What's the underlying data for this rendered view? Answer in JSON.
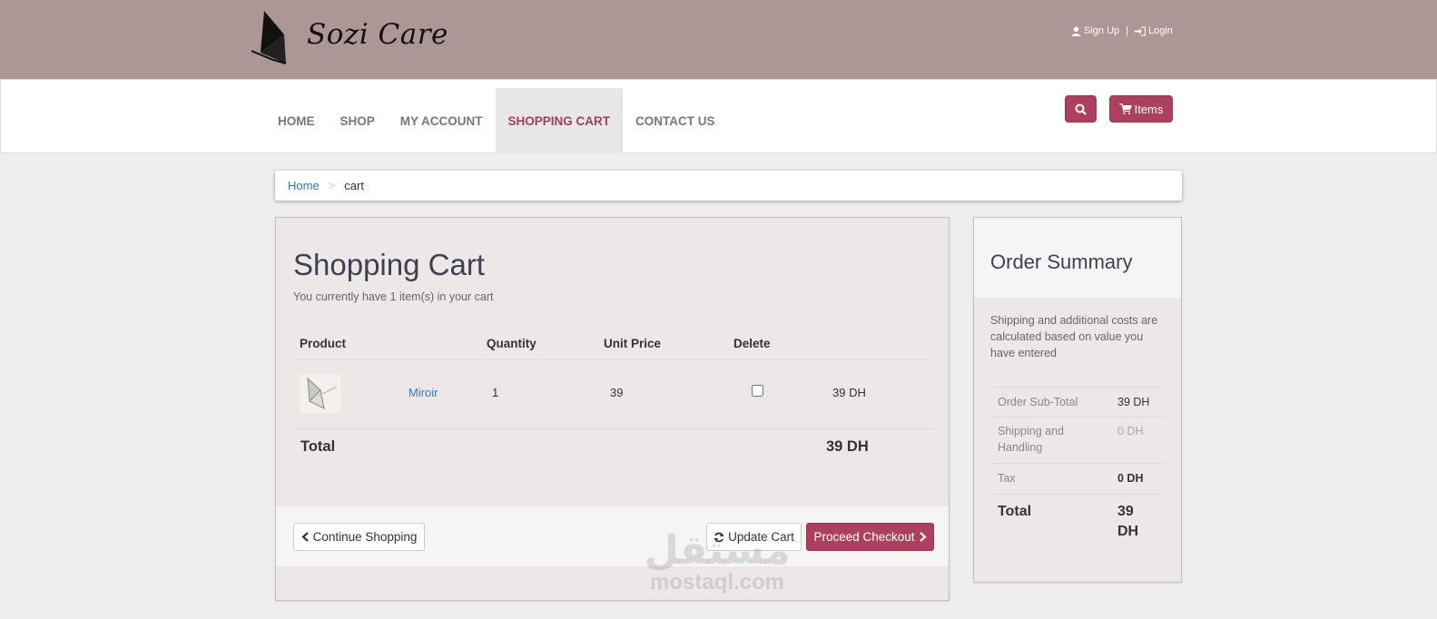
{
  "header": {
    "brand": "Sozi Care",
    "sign_up": "Sign Up",
    "separator": "|",
    "login": "Login"
  },
  "nav": {
    "items": [
      "HOME",
      "SHOP",
      "MY ACCOUNT",
      "SHOPPING CART",
      "CONTACT US"
    ],
    "active": "SHOPPING CART",
    "items_button": "Items"
  },
  "breadcrumb": {
    "home": "Home",
    "separator": ">",
    "current": "cart"
  },
  "cart": {
    "title": "Shopping Cart",
    "subtitle": "You currently have 1 item(s) in your cart",
    "columns": {
      "product": "Product",
      "quantity": "Quantity",
      "unit_price": "Unit Price",
      "delete": "Delete"
    },
    "rows": [
      {
        "name": "Miroir",
        "quantity": "1",
        "unit_price": "39",
        "delete_checked": false,
        "line_total": "39 DH"
      }
    ],
    "total_label": "Total",
    "total_value": "39 DH",
    "continue_button": "Continue Shopping",
    "update_button": "Update Cart",
    "checkout_button": "Proceed Checkout"
  },
  "summary": {
    "title": "Order Summary",
    "note": "Shipping and additional costs are calculated based on value you have entered",
    "rows": [
      {
        "label": "Order Sub-Total",
        "value": "39 DH"
      },
      {
        "label": "Shipping and Handling",
        "value": "0 DH"
      },
      {
        "label": "Tax",
        "value": "0 DH"
      }
    ],
    "total_label": "Total",
    "total_value": "39 DH"
  },
  "watermark": {
    "arabic": "مستقل",
    "latin": "mostaql.com"
  },
  "colors": {
    "header_bg": "#ad9796",
    "accent": "#ad405e",
    "link": "#337ab7",
    "panel_bg": "#ede7e7"
  }
}
